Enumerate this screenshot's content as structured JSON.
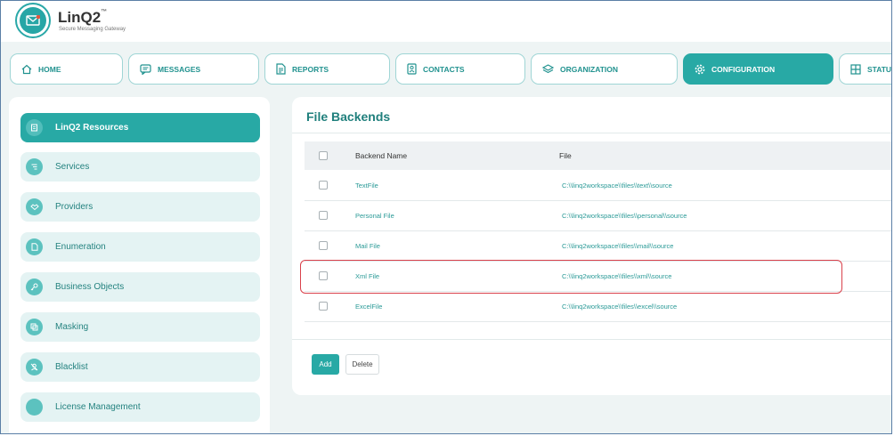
{
  "app": {
    "name": "LinQ2",
    "trademark": "™",
    "tagline": "Secure Messaging Gateway"
  },
  "nav": {
    "tabs": [
      {
        "label": "HOME",
        "icon": "home-icon"
      },
      {
        "label": "MESSAGES",
        "icon": "message-icon"
      },
      {
        "label": "REPORTS",
        "icon": "report-icon"
      },
      {
        "label": "CONTACTS",
        "icon": "contact-icon"
      },
      {
        "label": "ORGANIZATION",
        "icon": "layers-icon"
      },
      {
        "label": "CONFIGURATION",
        "icon": "gear-icon",
        "active": true
      },
      {
        "label": "STATUS",
        "icon": "grid-icon"
      }
    ]
  },
  "sidebar": {
    "items": [
      {
        "label": "LinQ2 Resources",
        "active": true
      },
      {
        "label": "Services"
      },
      {
        "label": "Providers"
      },
      {
        "label": "Enumeration"
      },
      {
        "label": "Business Objects"
      },
      {
        "label": "Masking"
      },
      {
        "label": "Blacklist"
      },
      {
        "label": "License Management"
      }
    ]
  },
  "main": {
    "title": "File Backends",
    "columns": {
      "name": "Backend Name",
      "file": "File"
    },
    "rows": [
      {
        "name": "TextFile",
        "file": "C:\\\\linq2workspace\\\\files\\\\text\\\\source"
      },
      {
        "name": "Personal File",
        "file": "C:\\\\linq2workspace\\\\files\\\\personal\\\\source"
      },
      {
        "name": "Mail File",
        "file": "C:\\\\linq2workspace\\\\files\\\\mail\\\\source"
      },
      {
        "name": "Xml File",
        "file": "C:\\\\linq2workspace\\\\files\\\\xml\\\\source"
      },
      {
        "name": "ExcelFile",
        "file": "C:\\\\linq2workspace\\\\files\\\\excel\\\\source"
      }
    ],
    "buttons": {
      "add": "Add",
      "delete": "Delete"
    }
  },
  "colors": {
    "accent": "#28a9a5",
    "highlight": "#d9414b"
  }
}
